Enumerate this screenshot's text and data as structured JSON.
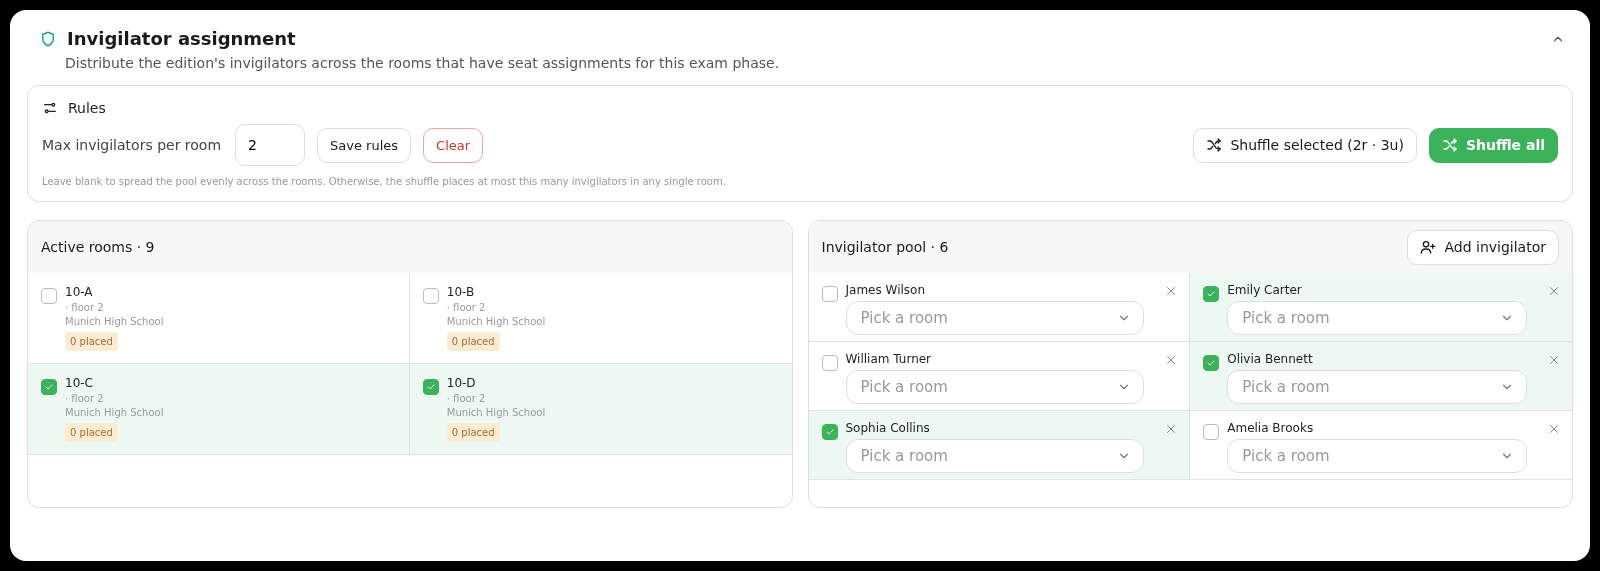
{
  "section": {
    "title": "Invigilator assignment",
    "subtitle": "Distribute the edition's invigilators across the rooms that have seat assignments for this exam phase.",
    "expanded": true
  },
  "rules": {
    "title": "Rules",
    "max_label": "Max invigilators per room",
    "max_value": "2",
    "save_button": "Save rules",
    "clear_button": "Clear",
    "shuffle_selected_button": "Shuffle selected (2r · 3u)",
    "shuffle_all_button": "Shuffle all",
    "hint": "Leave blank to spread the pool evenly across the rooms. Otherwise, the shuffle places at most this many invigilators in any single room."
  },
  "rooms": {
    "title": "Active rooms · 9",
    "items": [
      {
        "name": "10-A",
        "floor": "· floor 2",
        "school": "Munich High School",
        "badge": "0 placed",
        "selected": false
      },
      {
        "name": "10-B",
        "floor": "· floor 2",
        "school": "Munich High School",
        "badge": "0 placed",
        "selected": false
      },
      {
        "name": "10-C",
        "floor": "· floor 2",
        "school": "Munich High School",
        "badge": "0 placed",
        "selected": true
      },
      {
        "name": "10-D",
        "floor": "· floor 2",
        "school": "Munich High School",
        "badge": "0 placed",
        "selected": true
      }
    ]
  },
  "pool": {
    "title": "Invigilator pool · 6",
    "add_button": "Add invigilator",
    "items": [
      {
        "name": "James Wilson",
        "placeholder": "Pick a room",
        "selected": false
      },
      {
        "name": "Emily Carter",
        "placeholder": "Pick a room",
        "selected": true
      },
      {
        "name": "William Turner",
        "placeholder": "Pick a room",
        "selected": false
      },
      {
        "name": "Olivia Bennett",
        "placeholder": "Pick a room",
        "selected": true
      },
      {
        "name": "Sophia Collins",
        "placeholder": "Pick a room",
        "selected": true
      },
      {
        "name": "Amelia Brooks",
        "placeholder": "Pick a room",
        "selected": false
      }
    ]
  }
}
